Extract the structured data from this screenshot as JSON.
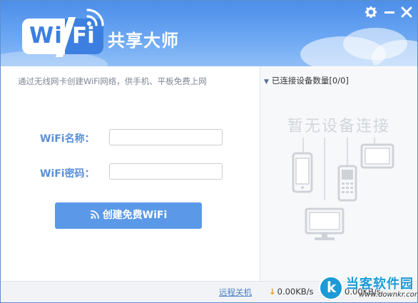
{
  "app": {
    "logo_wi": "Wi",
    "logo_fi": "Fi",
    "title": "共享大师"
  },
  "left": {
    "tip": "通过无线网卡创建WiFi网络，供手机、平板免费上网",
    "name_label": "WiFi名称：",
    "password_label": "WiFi密码：",
    "name_value": "",
    "password_value": "",
    "create_button": "创建免费WiFi"
  },
  "right": {
    "devices_header": "已连接设备数量[0/0]",
    "empty_text": "暂无设备连接"
  },
  "footer": {
    "remote_shutdown": "远程关机",
    "download_rate": "0.00KB/s",
    "upload_rate": "0.00KB/s"
  },
  "watermark": {
    "title": "当客软件园",
    "url": "www.downkr.com"
  },
  "colors": {
    "header_blue": "#4d8ee8",
    "button_blue": "#5b99e8",
    "label_blue": "#5a8fd8",
    "placeholder_gray": "#d2d6dc",
    "download_arrow": "#e59a1e"
  },
  "icons": [
    "settings-icon",
    "minimize-icon",
    "close-icon",
    "wifi-signal-icon",
    "collapse-triangle-icon",
    "download-arrow-icon"
  ]
}
